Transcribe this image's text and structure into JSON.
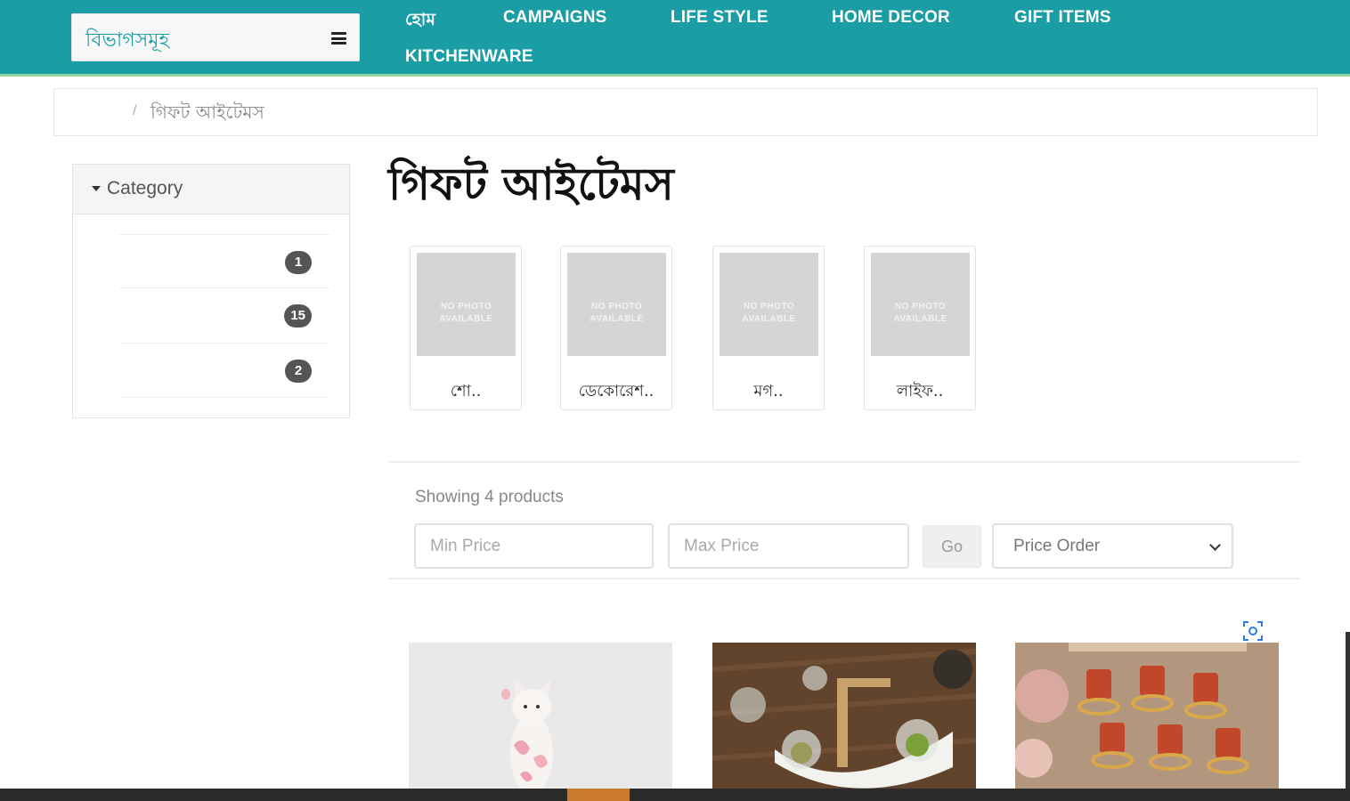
{
  "header": {
    "departments_label": "বিভাগসমূহ",
    "nav": [
      {
        "label": "হোম"
      },
      {
        "label": "CAMPAIGNS"
      },
      {
        "label": "LIFE STYLE"
      },
      {
        "label": "HOME DECOR"
      },
      {
        "label": "GIFT ITEMS"
      },
      {
        "label": "KITCHENWARE"
      }
    ]
  },
  "breadcrumb": {
    "separator": "/",
    "current": "গিফট আইটেমস"
  },
  "sidebar": {
    "title": "Category",
    "items": [
      {
        "count": "1"
      },
      {
        "count": "15"
      },
      {
        "count": "2"
      }
    ]
  },
  "main": {
    "title": "গিফট আইটেমস",
    "subcategories": [
      {
        "placeholder": "NO PHOTO AVAILABLE",
        "name": "শো.."
      },
      {
        "placeholder": "NO PHOTO AVAILABLE",
        "name": "ডেকোরেশ.."
      },
      {
        "placeholder": "NO PHOTO AVAILABLE",
        "name": "মগ.."
      },
      {
        "placeholder": "NO PHOTO AVAILABLE",
        "name": "লাইফ.."
      }
    ],
    "showing_text": "Showing 4 products",
    "filters": {
      "min_placeholder": "Min Price",
      "max_placeholder": "Max Price",
      "go_label": "Go",
      "sort_selected": "Price Order"
    }
  },
  "colors": {
    "header_bg": "#1b9da5",
    "badge_bg": "#555555"
  }
}
